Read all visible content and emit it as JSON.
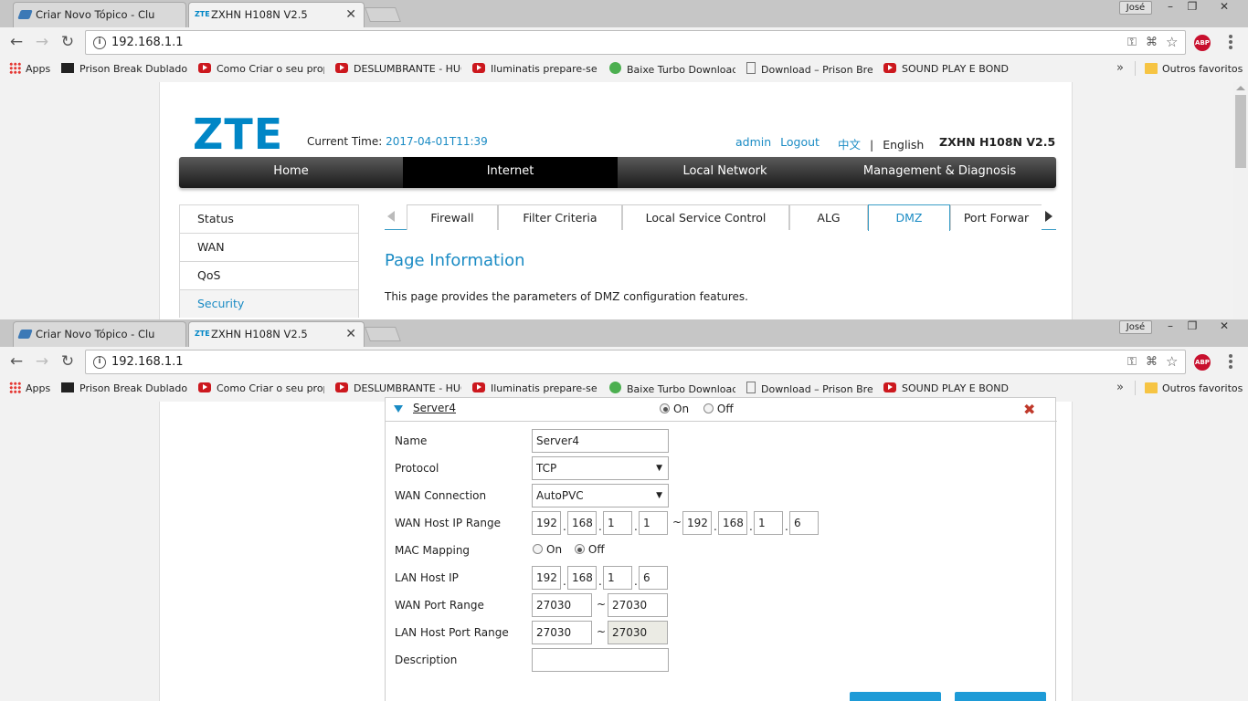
{
  "browser": {
    "tabs": [
      {
        "title": "Criar Novo Tópico - Clube d",
        "active": false
      },
      {
        "title": "ZXHN H108N V2.5",
        "active": true
      }
    ],
    "tab_icon_label": "ZTE",
    "user": "José",
    "window_controls": [
      "minimize",
      "restore",
      "close"
    ],
    "url": "192.168.1.1",
    "nav": {
      "back": "←",
      "forward": "→",
      "reload": "↻"
    },
    "omnibox_icons": [
      "key-icon",
      "translate-icon",
      "star-icon"
    ],
    "abp_label": "ABP",
    "bookmarks": [
      {
        "label": "Apps",
        "icon": "apps-grid-icon"
      },
      {
        "label": "Prison Break Dublado – C",
        "icon": "film-icon"
      },
      {
        "label": "Como Criar o seu propric",
        "icon": "youtube-icon"
      },
      {
        "label": "DESLUMBRANTE - HUGO",
        "icon": "youtube-icon"
      },
      {
        "label": "Iluminatis prepare-se dv",
        "icon": "youtube-icon"
      },
      {
        "label": "Baixe Turbo Downloads",
        "icon": "plus-icon"
      },
      {
        "label": "Download – Prison Break",
        "icon": "document-icon"
      },
      {
        "label": "SOUND PLAY E BONDE T",
        "icon": "youtube-icon"
      }
    ],
    "more_bookmarks": "»",
    "other_bookmarks": "Outros favoritos"
  },
  "router": {
    "logo": "ZTE",
    "current_time_label": "Current Time:",
    "current_time": "2017-04-01T11:39",
    "user_link": "admin",
    "logout_link": "Logout",
    "lang_zh": "中文",
    "lang_sep": "|",
    "lang_en": "English",
    "model": "ZXHN H108N V2.5",
    "main_nav": [
      {
        "label": "Home",
        "active": false
      },
      {
        "label": "Internet",
        "active": true
      },
      {
        "label": "Local Network",
        "active": false
      },
      {
        "label": "Management & Diagnosis",
        "active": false
      }
    ],
    "side_menu": [
      {
        "label": "Status",
        "active": false
      },
      {
        "label": "WAN",
        "active": false
      },
      {
        "label": "QoS",
        "active": false
      },
      {
        "label": "Security",
        "active": true
      }
    ],
    "sub_tabs": [
      {
        "label": "Firewall",
        "active": false
      },
      {
        "label": "Filter Criteria",
        "active": false
      },
      {
        "label": "Local Service Control",
        "active": false
      },
      {
        "label": "ALG",
        "active": false
      },
      {
        "label": "DMZ",
        "active": true
      },
      {
        "label": "Port Forwar",
        "active": false
      }
    ],
    "page_info_title": "Page Information",
    "page_info_desc": "This page provides the parameters of DMZ configuration features."
  },
  "server_form": {
    "server_name": "Server4",
    "enable_on": "On",
    "enable_off": "Off",
    "enabled": true,
    "labels": {
      "name": "Name",
      "protocol": "Protocol",
      "wan_connection": "WAN Connection",
      "wan_host_ip_range": "WAN Host IP Range",
      "mac_mapping": "MAC Mapping",
      "lan_host_ip": "LAN Host IP",
      "wan_port_range": "WAN Port Range",
      "lan_host_port_range": "LAN Host Port Range",
      "description": "Description"
    },
    "name_value": "Server4",
    "protocol_value": "TCP",
    "wan_connection_value": "AutoPVC",
    "wan_ip_start": [
      "192",
      "168",
      "1",
      "1"
    ],
    "wan_ip_end": [
      "192",
      "168",
      "1",
      "6"
    ],
    "range_sep": "~",
    "ip_sep": ".",
    "mac_on": "On",
    "mac_off": "Off",
    "mac_mapping_enabled": false,
    "lan_host_ip": [
      "192",
      "168",
      "1",
      "6"
    ],
    "wan_port_start": "27030",
    "wan_port_end": "27030",
    "lan_port_start": "27030",
    "lan_port_end": "27030",
    "description_value": ""
  },
  "colors": {
    "accent": "#1a8bc4",
    "brand": "#0086c6",
    "nav_dark": "#1a1a1a",
    "button": "#1e9bd7",
    "delete": "#c0392b"
  }
}
